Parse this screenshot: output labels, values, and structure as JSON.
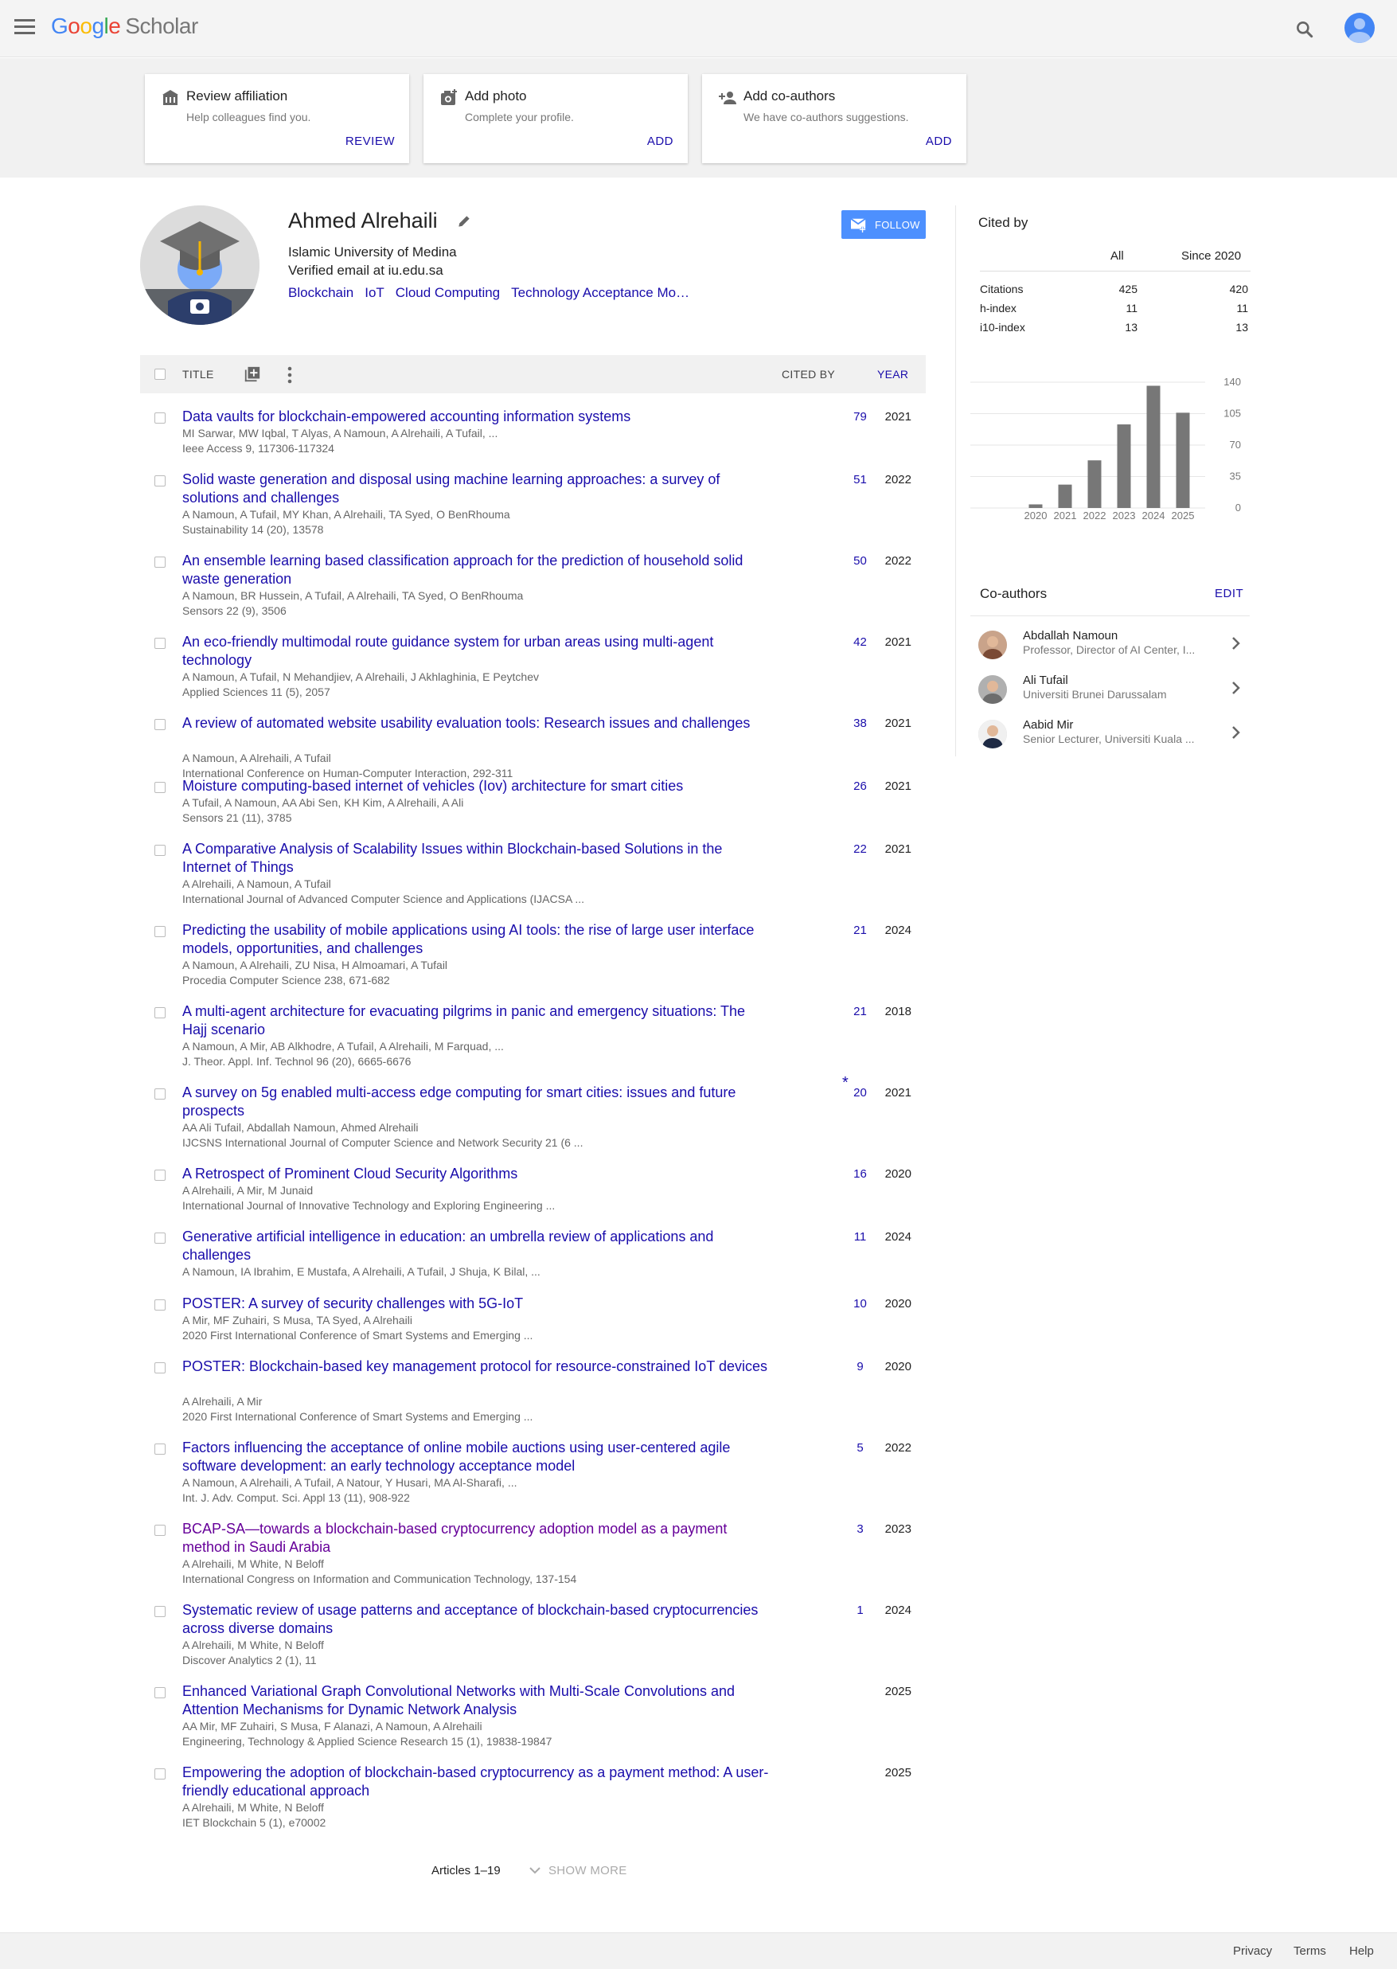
{
  "header": {
    "logo_google": [
      "G",
      "o",
      "o",
      "g",
      "l",
      "e"
    ],
    "logo_scholar": "Scholar"
  },
  "banner": [
    {
      "title": "Review affiliation",
      "subtitle": "Help colleagues find you.",
      "action": "REVIEW",
      "icon": "building-icon"
    },
    {
      "title": "Add photo",
      "subtitle": "Complete your profile.",
      "action": "ADD",
      "icon": "camera-icon"
    },
    {
      "title": "Add co-authors",
      "subtitle": "We have co-authors suggestions.",
      "action": "ADD",
      "icon": "person-add-icon"
    }
  ],
  "profile": {
    "name": "Ahmed Alrehaili",
    "affiliation": "Islamic University of Medina",
    "email": "Verified email at iu.edu.sa",
    "interests": [
      "Blockchain",
      "IoT",
      "Cloud Computing",
      "Technology Acceptance Mo…"
    ],
    "follow_label": "FOLLOW"
  },
  "table": {
    "col_title": "TITLE",
    "col_cited": "CITED BY",
    "col_year": "YEAR"
  },
  "articles": [
    {
      "title": "Data vaults for blockchain-empowered accounting information systems",
      "authors": "MI Sarwar, MW Iqbal, T Alyas, A Namoun, A Alrehaili, A Tufail, ...",
      "venue": "Ieee Access 9, 117306-117324",
      "cited": "79",
      "year": "2021"
    },
    {
      "title": "Solid waste generation and disposal using machine learning approaches: a survey of solutions and challenges",
      "authors": "A Namoun, A Tufail, MY Khan, A Alrehaili, TA Syed, O BenRhouma",
      "venue": "Sustainability 14 (20), 13578",
      "cited": "51",
      "year": "2022"
    },
    {
      "title": "An ensemble learning based classification approach for the prediction of household solid waste generation",
      "authors": "A Namoun, BR Hussein, A Tufail, A Alrehaili, TA Syed, O BenRhouma",
      "venue": "Sensors 22 (9), 3506",
      "cited": "50",
      "year": "2022"
    },
    {
      "title": "An eco-friendly multimodal route guidance system for urban areas using multi-agent technology",
      "authors": "A Namoun, A Tufail, N Mehandjiev, A Alrehaili, J Akhlaghinia, E Peytchev",
      "venue": "Applied Sciences 11 (5), 2057",
      "cited": "42",
      "year": "2021"
    },
    {
      "title": "A review of automated website usability evaluation tools: Research issues and challenges",
      "authors": "A Namoun, A Alrehaili, A Tufail",
      "venue": "International Conference on Human-Computer Interaction, 292-311",
      "cited": "38",
      "year": "2021"
    },
    {
      "title": "Moisture computing-based internet of vehicles (Iov) architecture for smart cities",
      "authors": "A Tufail, A Namoun, AA Abi Sen, KH Kim, A Alrehaili, A Ali",
      "venue": "Sensors 21 (11), 3785",
      "cited": "26",
      "year": "2021"
    },
    {
      "title": "A Comparative Analysis of Scalability Issues within Blockchain-based Solutions in the Internet of Things",
      "authors": "A Alrehaili, A Namoun, A Tufail",
      "venue": "International Journal of Advanced Computer Science and Applications (IJACSA ...",
      "cited": "22",
      "year": "2021"
    },
    {
      "title": "Predicting the usability of mobile applications using AI tools: the rise of large user interface models, opportunities, and challenges",
      "authors": "A Namoun, A Alrehaili, ZU Nisa, H Almoamari, A Tufail",
      "venue": "Procedia Computer Science 238, 671-682",
      "cited": "21",
      "year": "2024"
    },
    {
      "title": "A multi-agent architecture for evacuating pilgrims in panic and emergency situations: The Hajj scenario",
      "authors": "A Namoun, A Mir, AB Alkhodre, A Tufail, A Alrehaili, M Farquad, ...",
      "venue": "J. Theor. Appl. Inf. Technol 96 (20), 6665-6676",
      "cited": "21",
      "year": "2018"
    },
    {
      "title": "A survey on 5g enabled multi-access edge computing for smart cities: issues and future prospects",
      "authors": "AA Ali Tufail, Abdallah Namoun, Ahmed Alrehaili",
      "venue": "IJCSNS International Journal of Computer Science and Network Security 21 (6 ...",
      "cited": "20",
      "year": "2021",
      "star": "*"
    },
    {
      "title": "A Retrospect of Prominent Cloud Security Algorithms",
      "authors": "A Alrehaili, A Mir, M Junaid",
      "venue": "International Journal of Innovative Technology and Exploring Engineering ...",
      "cited": "16",
      "year": "2020"
    },
    {
      "title": "Generative artificial intelligence in education: an umbrella review of applications and challenges",
      "authors": "A Namoun, IA Ibrahim, E Mustafa, A Alrehaili, A Tufail, J Shuja, K Bilal, ...",
      "venue": "",
      "cited": "11",
      "year": "2024"
    },
    {
      "title": "POSTER: A survey of security challenges with 5G-IoT",
      "authors": "A Mir, MF Zuhairi, S Musa, TA Syed, A Alrehaili",
      "venue": "2020 First International Conference of Smart Systems and Emerging ...",
      "cited": "10",
      "year": "2020"
    },
    {
      "title": "POSTER: Blockchain-based key management protocol for resource-constrained IoT devices",
      "authors": "A Alrehaili, A Mir",
      "venue": "2020 First International Conference of Smart Systems and Emerging ...",
      "cited": "9",
      "year": "2020"
    },
    {
      "title": "Factors influencing the acceptance of online mobile auctions using user-centered agile software development: an early technology acceptance model",
      "authors": "A Namoun, A Alrehaili, A Tufail, A Natour, Y Husari, MA Al-Sharafi, ...",
      "venue": "Int. J. Adv. Comput. Sci. Appl 13 (11), 908-922",
      "cited": "5",
      "year": "2022"
    },
    {
      "title": "BCAP-SA—towards a blockchain-based cryptocurrency adoption model as a payment method in Saudi Arabia",
      "authors": "A Alrehaili, M White, N Beloff",
      "venue": "International Congress on Information and Communication Technology, 137-154",
      "cited": "3",
      "year": "2023",
      "visited": true
    },
    {
      "title": "Systematic review of usage patterns and acceptance of blockchain-based cryptocurrencies across diverse domains",
      "authors": "A Alrehaili, M White, N Beloff",
      "venue": "Discover Analytics 2 (1), 11",
      "cited": "1",
      "year": "2024"
    },
    {
      "title": "Enhanced Variational Graph Convolutional Networks with Multi-Scale Convolutions and Attention Mechanisms for Dynamic Network Analysis",
      "authors": "AA Mir, MF Zuhairi, S Musa, F Alanazi, A Namoun, A Alrehaili",
      "venue": "Engineering, Technology & Applied Science Research 15 (1), 19838-19847",
      "cited": "",
      "year": "2025"
    },
    {
      "title": "Empowering the adoption of blockchain-based cryptocurrency as a payment method: A user-friendly educational approach",
      "authors": "A Alrehaili, M White, N Beloff",
      "venue": "IET Blockchain 5 (1), e70002",
      "cited": "",
      "year": "2025"
    }
  ],
  "pagination": {
    "range": "Articles 1–19",
    "show_more": "SHOW MORE"
  },
  "cited_by": {
    "title": "Cited by",
    "col_all": "All",
    "col_since": "Since 2020",
    "rows": [
      {
        "label": "Citations",
        "all": "425",
        "since": "420"
      },
      {
        "label": "h-index",
        "all": "11",
        "since": "11"
      },
      {
        "label": "i10-index",
        "all": "13",
        "since": "13"
      }
    ]
  },
  "chart_data": {
    "type": "bar",
    "categories": [
      "2020",
      "2021",
      "2022",
      "2023",
      "2024",
      "2025"
    ],
    "values": [
      4,
      26,
      53,
      93,
      136,
      106
    ],
    "ylim": [
      0,
      140
    ],
    "yticks": [
      "0",
      "35",
      "70",
      "105",
      "140"
    ],
    "title": "",
    "xlabel": "",
    "ylabel": "",
    "bar_color": "#777777"
  },
  "coauthors": {
    "title": "Co-authors",
    "edit_label": "EDIT",
    "list": [
      {
        "name": "Abdallah Namoun",
        "affiliation": "Professor, Director of AI Center, I..."
      },
      {
        "name": "Ali Tufail",
        "affiliation": "Universiti Brunei Darussalam"
      },
      {
        "name": "Aabid Mir",
        "affiliation": "Senior Lecturer, Universiti Kuala ..."
      }
    ]
  },
  "footer": {
    "privacy": "Privacy",
    "terms": "Terms",
    "help": "Help"
  },
  "colors": {
    "link": "#1a0dab",
    "visited": "#660099",
    "follow_bg": "#4d90fe"
  }
}
